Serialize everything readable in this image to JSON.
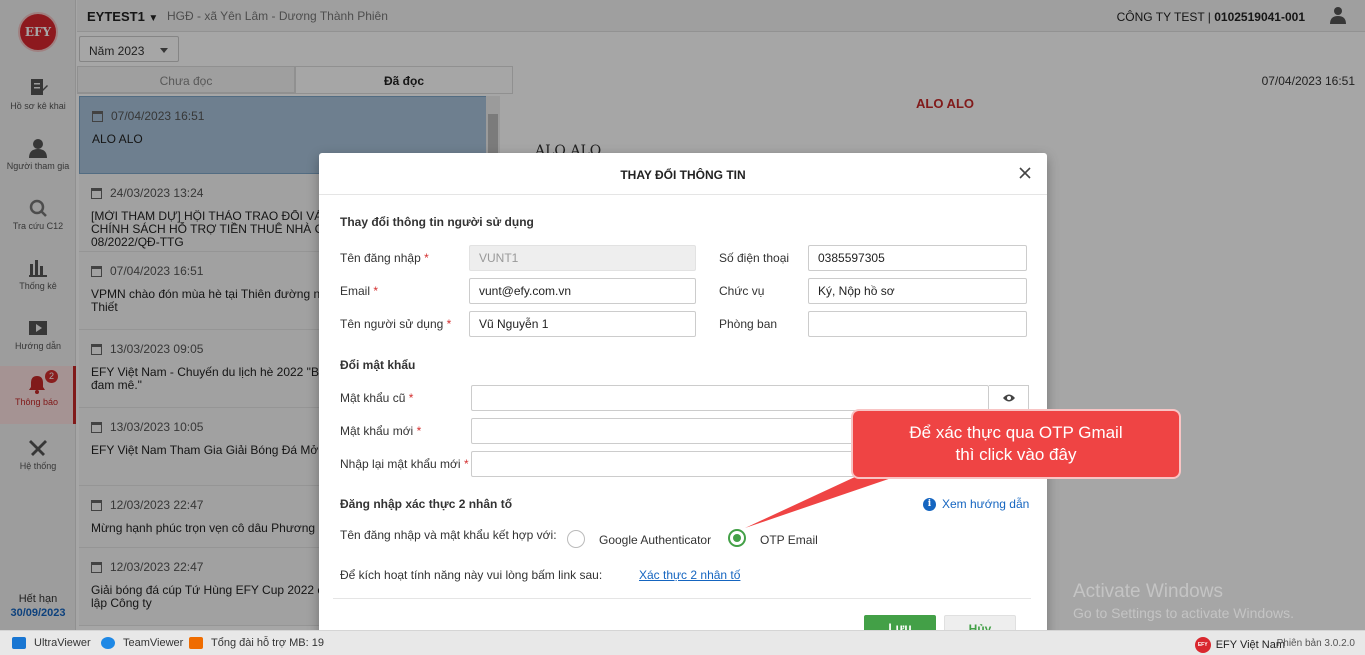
{
  "app": {
    "logo": "EFY"
  },
  "sidebar": {
    "items": [
      {
        "label": "Hồ sơ kê khai",
        "icon": "file-edit-icon"
      },
      {
        "label": "Người tham gia",
        "icon": "user-icon"
      },
      {
        "label": "Tra cứu C12",
        "icon": "search-icon"
      },
      {
        "label": "Thống kê",
        "icon": "bar-chart-icon"
      },
      {
        "label": "Hướng dẫn",
        "icon": "guide-icon"
      },
      {
        "label": "Thông báo",
        "icon": "bell-icon",
        "badge": "2",
        "active": true
      },
      {
        "label": "Hệ thống",
        "icon": "tools-icon"
      }
    ],
    "expire_label": "Hết hạn",
    "expire_date": "30/09/2023"
  },
  "header": {
    "org": "EYTEST1",
    "sub": "HGĐ - xã Yên Lâm - Dương Thành Phiên",
    "company": "CÔNG TY TEST | ",
    "company_code": "0102519041-001"
  },
  "year_select": "Năm 2023",
  "tabs": [
    {
      "label": "Chưa đọc"
    },
    {
      "label": "Đã đọc"
    }
  ],
  "detail": {
    "date": "07/04/2023 16:51",
    "title": "ALO ALO",
    "body": "ALO ALO"
  },
  "messages": [
    {
      "time": "07/04/2023 16:51",
      "title": "ALO ALO"
    },
    {
      "time": "24/03/2023 13:24",
      "title": "[MỜI THAM DỰ] HỘI THẢO TRAO ĐỔI VÀ\nCHÍNH SÁCH HỖ TRỢ TIỀN THUÊ NHÀ C\n08/2022/QĐ-TTG"
    },
    {
      "time": "07/04/2023 16:51",
      "title": "VPMN chào đón mùa hè tại Thiên đường n\nThiết"
    },
    {
      "time": "13/03/2023 09:05",
      "title": "EFY Việt Nam - Chuyến du lịch hè 2022 \"B\nđam mê.\""
    },
    {
      "time": "13/03/2023 10:05",
      "title": "EFY Việt Nam Tham Gia Giải Bóng Đá Mở"
    },
    {
      "time": "12/03/2023 22:47",
      "title": "Mừng hạnh phúc trọn vẹn cô dâu Phương"
    },
    {
      "time": "12/03/2023 22:47",
      "title": "Giải bóng đá cúp Tứ Hùng EFY Cup 2022 c\nlập Công ty"
    }
  ],
  "modal": {
    "title": "THAY ĐỔI THÔNG TIN",
    "section_user": "Thay đổi thông tin người sử dụng",
    "username_label": "Tên đăng nhập",
    "username_value": "VUNT1",
    "email_label": "Email",
    "email_value": "vunt@efy.com.vn",
    "fullname_label": "Tên người sử dụng",
    "fullname_value": "Vũ Nguyễn 1",
    "phone_label": "Số điện thoại",
    "phone_value": "0385597305",
    "position_label": "Chức vụ",
    "position_value": "Ký, Nộp hồ sơ",
    "dept_label": "Phòng ban",
    "dept_value": "",
    "section_password": "Đổi mật khẩu",
    "old_pw_label": "Mật khẩu cũ",
    "new_pw_label": "Mật khẩu mới",
    "confirm_pw_label": "Nhập lại mật khẩu mới",
    "section_2fa": "Đăng nhập xác thực 2 nhân tố",
    "help_link": "Xem hướng dẫn",
    "combine_label": "Tên đăng nhập và mật khẩu kết hợp với:",
    "option_google": "Google Authenticator",
    "option_otp": "OTP Email",
    "activate_label": "Để kích hoạt tính năng này vui lòng bấm link sau:",
    "activate_link": "Xác thực 2 nhân tố",
    "save": "Lưu",
    "cancel": "Hủy",
    "required_mark": "*"
  },
  "callout": {
    "line1": "Để xác thực qua OTP Gmail",
    "line2": "thì click vào đây"
  },
  "watermark": {
    "line1": "Activate Windows",
    "line2": "Go to Settings to activate Windows."
  },
  "statusbar": {
    "ultraviewer": "UltraViewer",
    "teamviewer": "TeamViewer",
    "hotline": "Tổng đài hỗ trợ MB: 19",
    "brand": "EFY Việt Nam",
    "version": "Phiên bản 3.0.2.0"
  },
  "colors": {
    "accent_red": "#c62828",
    "primary_green": "#43a047",
    "link_blue": "#1565c0"
  }
}
